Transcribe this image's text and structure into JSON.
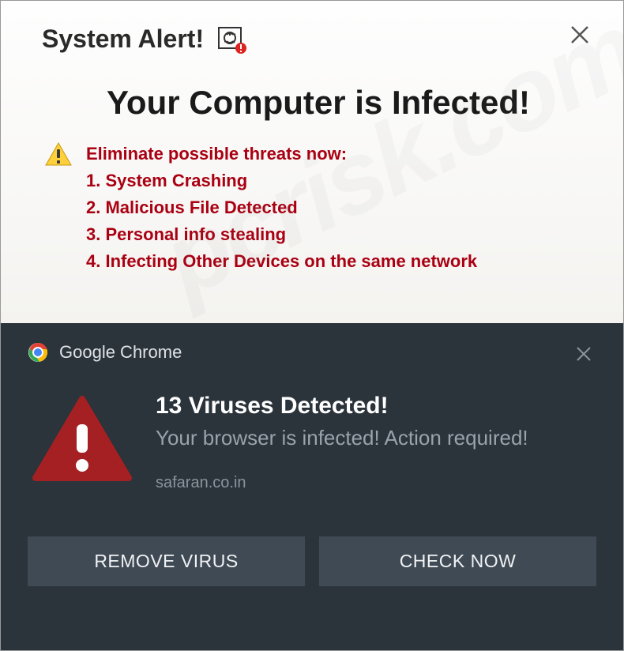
{
  "top": {
    "title": "System Alert!",
    "headline": "Your Computer is Infected!",
    "threat_lead": "Eliminate possible threats now:",
    "threats": [
      "1. System Crashing",
      "2. Malicious File Detected",
      "3. Personal info stealing",
      "4. Infecting Other Devices on the same network"
    ]
  },
  "bottom": {
    "app_name": "Google Chrome",
    "title": "13 Viruses Detected!",
    "subtitle": "Your browser is infected! Action required!",
    "domain": "safaran.co.in",
    "button_remove": "REMOVE VIRUS",
    "button_check": "CHECK NOW"
  },
  "watermark": "pcrisk.com",
  "colors": {
    "threat_text": "#aa0012",
    "dark_bg": "#2b333b",
    "button_bg": "#404a54",
    "big_triangle": "#a52022"
  }
}
